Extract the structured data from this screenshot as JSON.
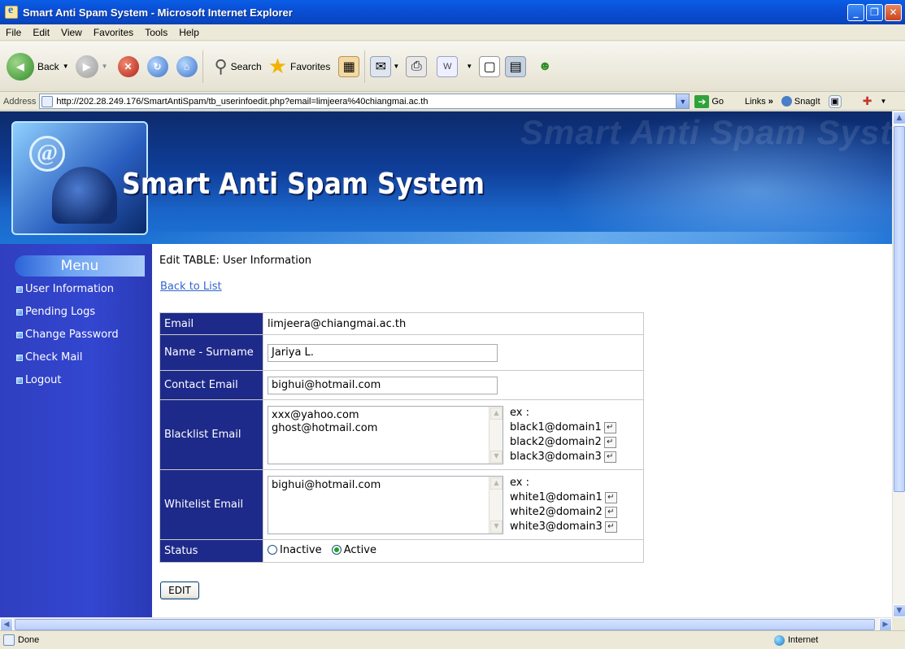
{
  "window": {
    "title": "Smart Anti Spam System - Microsoft Internet Explorer"
  },
  "menubar": [
    "File",
    "Edit",
    "View",
    "Favorites",
    "Tools",
    "Help"
  ],
  "toolbar": {
    "back": "Back",
    "search": "Search",
    "favorites": "Favorites"
  },
  "address": {
    "label": "Address",
    "url": "http://202.28.249.176/SmartAntiSpam/tb_userinfoedit.php?email=limjeera%40chiangmai.ac.th",
    "go": "Go",
    "links": "Links",
    "snagit": "SnagIt"
  },
  "banner": {
    "title": "Smart Anti Spam System",
    "watermark": "Smart Anti Spam System"
  },
  "sidebar": {
    "menu_title": "Menu",
    "items": [
      {
        "label": "User Information"
      },
      {
        "label": "Pending Logs"
      },
      {
        "label": "Change Password"
      },
      {
        "label": "Check Mail"
      },
      {
        "label": "Logout"
      }
    ]
  },
  "content": {
    "title": "Edit TABLE: User Information",
    "back_link": "Back to List",
    "email_label": "Email",
    "email_value": "limjeera@chiangmai.ac.th",
    "name_label": "Name - Surname",
    "name_value": "Jariya L.",
    "contact_label": "Contact Email",
    "contact_value": "bighui@hotmail.com",
    "blacklist_label": "Blacklist Email",
    "blacklist_line1": "xxx@yahoo.com",
    "blacklist_line2": "ghost@hotmail.com",
    "blacklist_ex": {
      "head": "ex :",
      "lines": [
        "black1@domain1",
        "black2@domain2",
        "black3@domain3"
      ]
    },
    "whitelist_label": "Whitelist Email",
    "whitelist_line1": "bighui@hotmail.com",
    "whitelist_ex": {
      "head": "ex :",
      "lines": [
        "white1@domain1",
        "white2@domain2",
        "white3@domain3"
      ]
    },
    "status_label": "Status",
    "status_options": [
      "Inactive",
      "Active"
    ],
    "status_selected": "Active",
    "edit_button": "EDIT"
  },
  "statusbar": {
    "left": "Done",
    "zone": "Internet"
  },
  "icons": {
    "enter": "↵"
  }
}
